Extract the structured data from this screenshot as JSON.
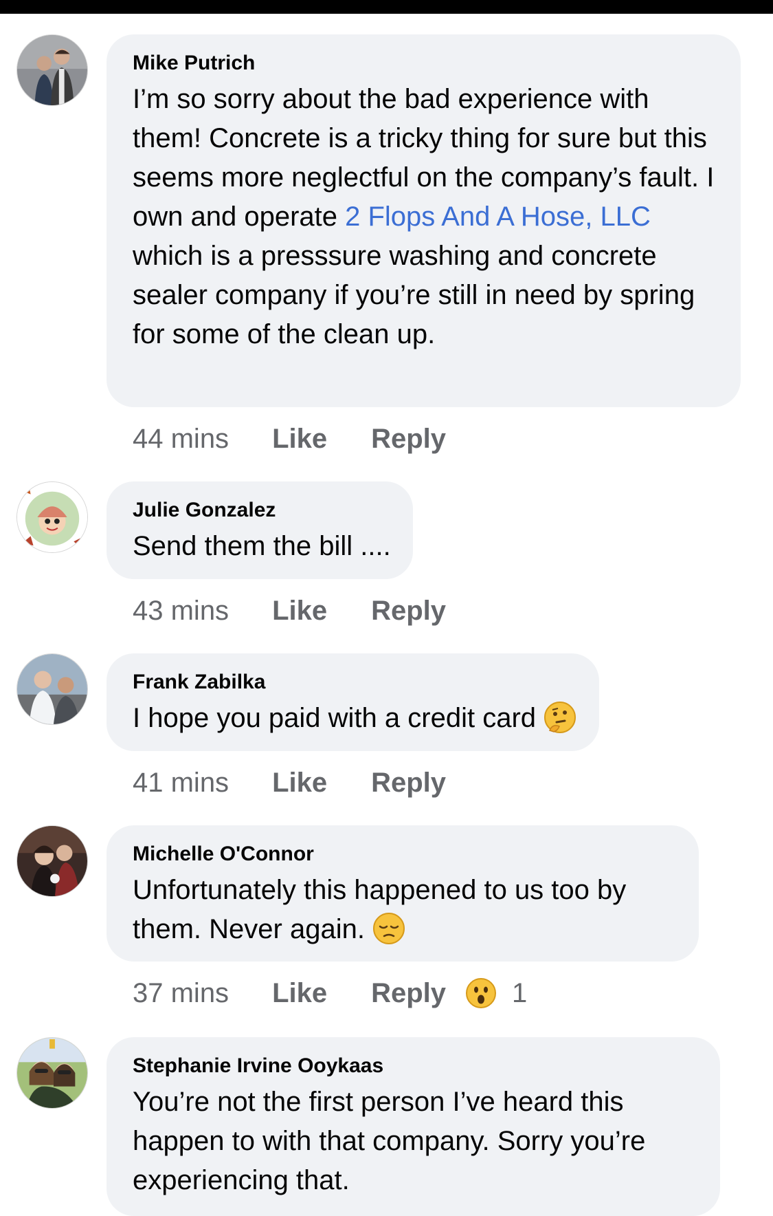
{
  "comments": [
    {
      "author": "Mike Putrich",
      "text_parts": [
        "I’m so sorry about the bad experience with them!   Concrete is a tricky thing for sure but this seems more neglectful on the company’s fault.  I own and operate ",
        "2 Flops And A Hose, LLC",
        " which is a presssure washing and concrete sealer company if you’re still in need by spring for some of the clean up."
      ],
      "time": "44 mins",
      "like_label": "Like",
      "reply_label": "Reply"
    },
    {
      "author": "Julie Gonzalez",
      "text": "Send them the bill ....",
      "time": "43 mins",
      "like_label": "Like",
      "reply_label": "Reply"
    },
    {
      "author": "Frank Zabilka",
      "text": "I hope you paid with a credit card",
      "emoji": "thinking-face-emoji",
      "time": "41 mins",
      "like_label": "Like",
      "reply_label": "Reply"
    },
    {
      "author": "Michelle O'Connor",
      "text": "Unfortunately this happened to us too by them. Never again.",
      "emoji": "pensive-face-emoji",
      "time": "37 mins",
      "like_label": "Like",
      "reply_label": "Reply",
      "reaction": {
        "icon": "wow-reaction-icon",
        "count": "1"
      }
    },
    {
      "author": "Stephanie Irvine Ooykaas",
      "text": "You’re not the first person I’ve heard this happen to with that company. Sorry you’re experiencing that."
    }
  ],
  "colors": {
    "bubble": "#f0f2f5",
    "link": "#3b6ed4",
    "meta": "#65676b",
    "text": "#050505"
  }
}
